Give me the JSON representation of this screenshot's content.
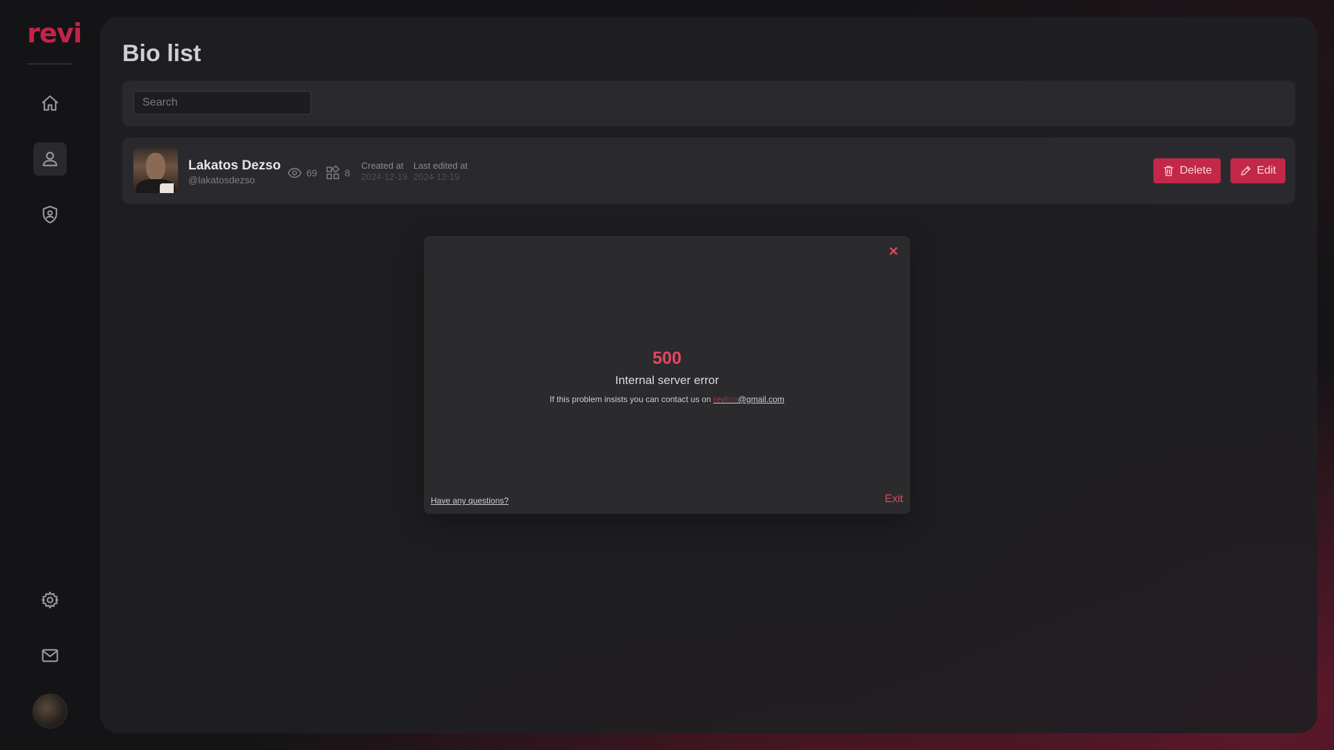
{
  "brand": {
    "logo": "revi",
    "accent": "#c42849"
  },
  "sidebar": {
    "items": [
      {
        "name": "home",
        "icon": "home-icon"
      },
      {
        "name": "profile",
        "icon": "user-icon",
        "active": true
      },
      {
        "name": "security",
        "icon": "shield-icon"
      },
      {
        "name": "settings",
        "icon": "gear-icon"
      },
      {
        "name": "mail",
        "icon": "mail-icon"
      }
    ]
  },
  "page": {
    "title": "Bio list"
  },
  "search": {
    "placeholder": "Search",
    "value": ""
  },
  "bios": [
    {
      "name": "Lakatos Dezso",
      "handle": "@lakatosdezso",
      "views": "69",
      "blocks": "8",
      "created_label": "Created at",
      "created_date": "2024-12-19",
      "edited_label": "Last edited at",
      "edited_date": "2024-12-19",
      "delete_label": "Delete",
      "edit_label": "Edit"
    }
  ],
  "modal": {
    "code": "500",
    "message": "Internal server error",
    "contact_prefix": "If this problem insists you can contact us on ",
    "email_part1": "revi",
    "email_part2": "bio",
    "email_part3": "@gmail.com",
    "questions_link": "Have any questions?",
    "exit_label": "Exit",
    "close_icon": "close-icon"
  }
}
